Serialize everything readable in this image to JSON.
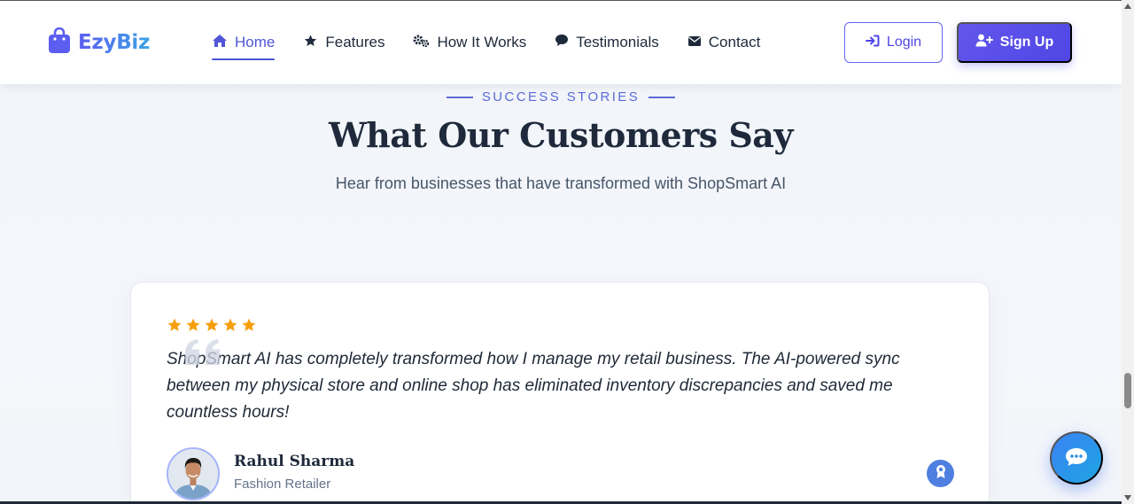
{
  "navbar": {
    "brand": "EzyBiz",
    "links": [
      {
        "label": "Home",
        "icon": "home-icon",
        "active": true
      },
      {
        "label": "Features",
        "icon": "star-icon"
      },
      {
        "label": "How It Works",
        "icon": "gears-icon"
      },
      {
        "label": "Testimonials",
        "icon": "comment-icon"
      },
      {
        "label": "Contact",
        "icon": "envelope-icon"
      }
    ],
    "login_label": "Login",
    "signup_label": "Sign Up"
  },
  "section": {
    "eyebrow": "SUCCESS STORIES",
    "title": "What Our Customers Say",
    "subtitle": "Hear from businesses that have transformed with ShopSmart AI"
  },
  "testimonial": {
    "rating": 5,
    "quote": "ShopSmart AI has completely transformed how I manage my retail business. The AI-powered sync between my physical store and online shop has eliminated inventory discrepancies and saved me countless hours!",
    "author_name": "Rahul Sharma",
    "author_role": "Fashion Retailer",
    "badge_icon": "award-icon"
  },
  "chat": {
    "icon": "chat-icon"
  },
  "colors": {
    "accent": "#4f46e5",
    "star": "#f59e0b",
    "brand_gradient_start": "#5b5ef0",
    "brand_gradient_end": "#3aa3e6",
    "chat": "#2f8fe8"
  }
}
